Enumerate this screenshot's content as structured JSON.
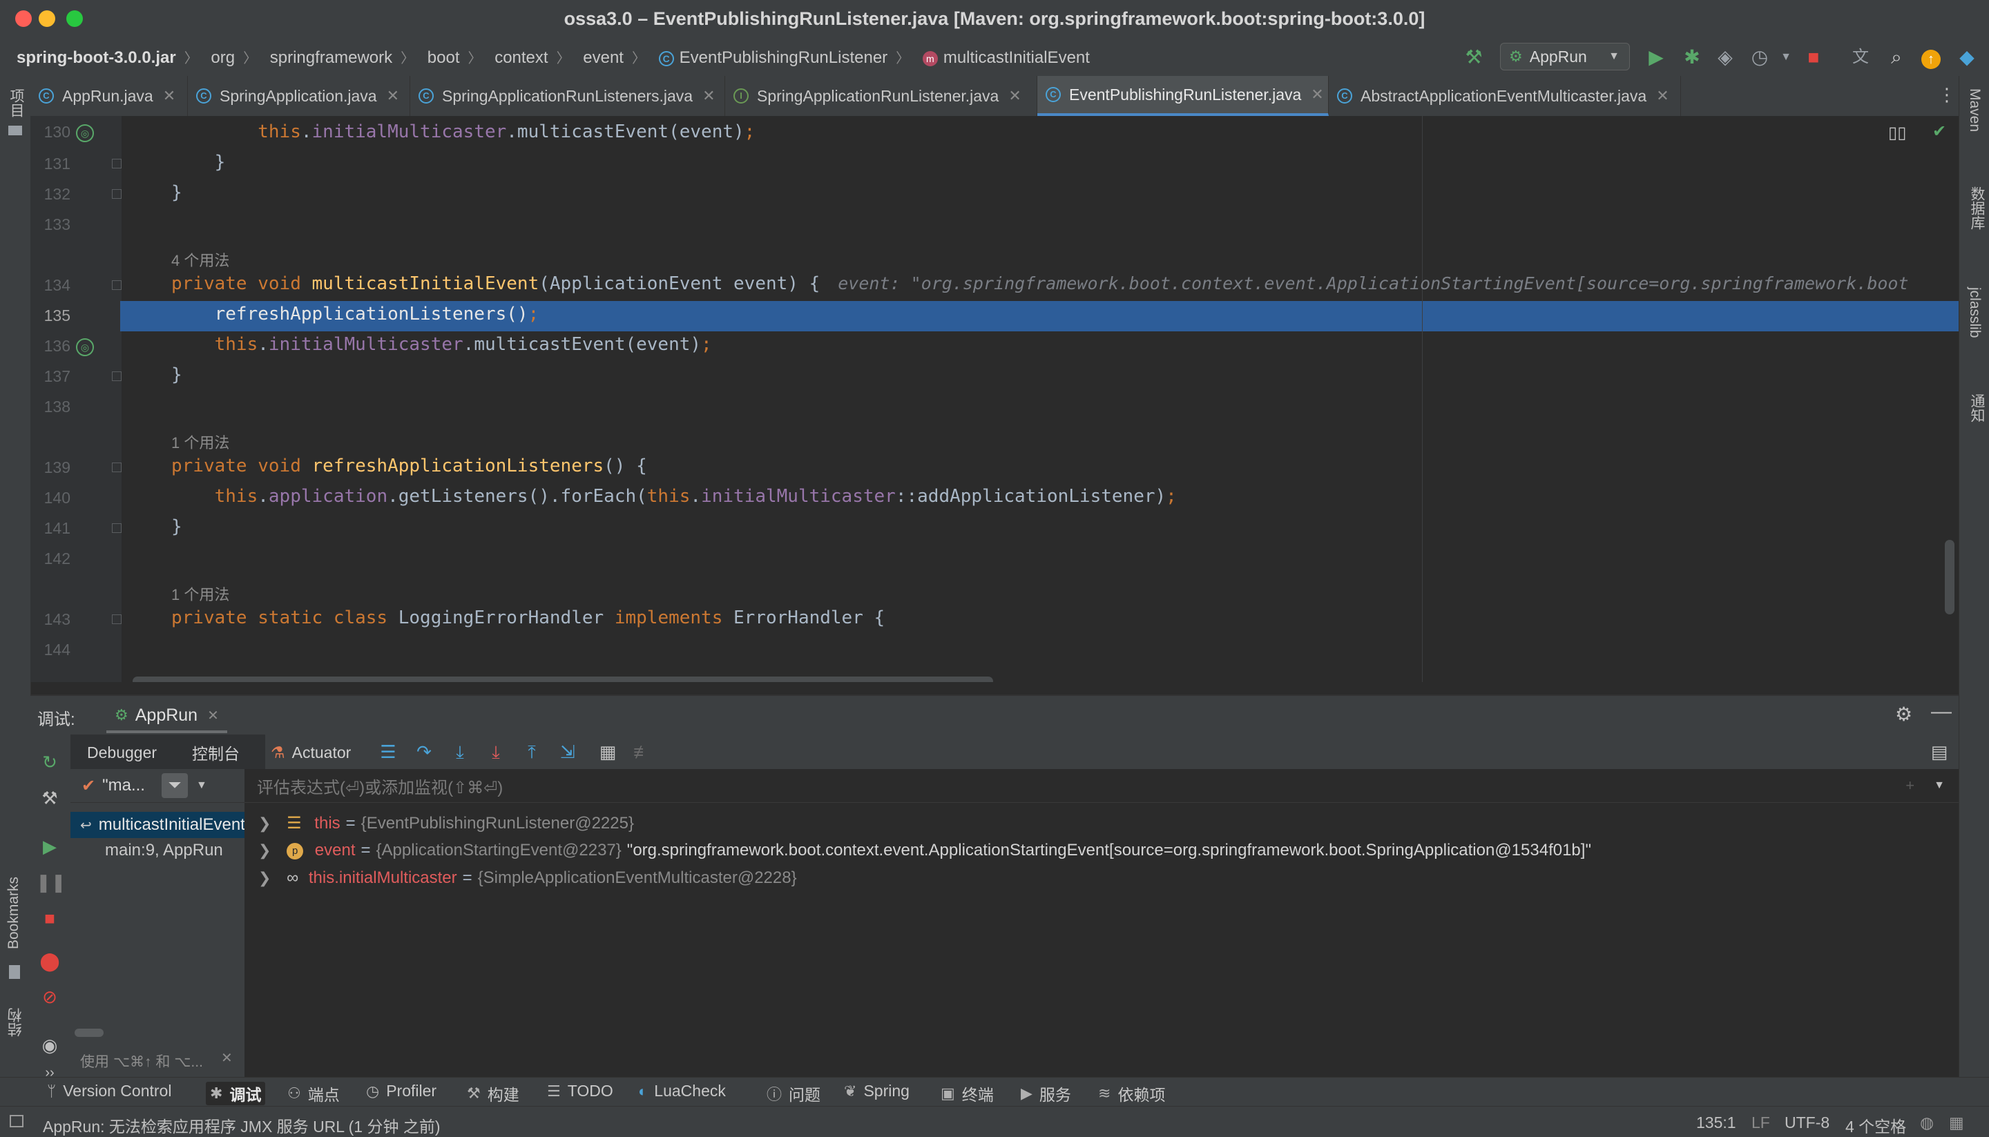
{
  "window": {
    "title": "ossa3.0 – EventPublishingRunListener.java [Maven: org.springframework.boot:spring-boot:3.0.0]"
  },
  "breadcrumb": [
    "spring-boot-3.0.0.jar",
    "org",
    "springframework",
    "boot",
    "context",
    "event",
    "EventPublishingRunListener",
    "multicastInitialEvent"
  ],
  "run_config": {
    "label": "AppRun"
  },
  "tabs": [
    {
      "label": "AppRun.java",
      "active": false
    },
    {
      "label": "SpringApplication.java",
      "active": false
    },
    {
      "label": "SpringApplicationRunListeners.java",
      "active": false
    },
    {
      "label": "SpringApplicationRunListener.java",
      "active": false
    },
    {
      "label": "EventPublishingRunListener.java",
      "active": true
    },
    {
      "label": "AbstractApplicationEventMulticaster.java",
      "active": false
    }
  ],
  "left_strip": {
    "project": "项目",
    "bookmarks": "Bookmarks",
    "structure": "结构"
  },
  "right_strip": {
    "maven": "Maven",
    "database": "数据库",
    "jclasslib": "jclasslib",
    "notifications": "通知"
  },
  "editor": {
    "lines": [
      {
        "num": "130",
        "code": "        this.initialMulticaster.multicastEvent(event);"
      },
      {
        "num": "131",
        "code": "    }"
      },
      {
        "num": "132",
        "code": "}"
      },
      {
        "num": "133",
        "code": ""
      },
      {
        "num": "134",
        "code": "private void multicastInitialEvent(ApplicationEvent event) {",
        "hint": "4 个用法"
      },
      {
        "num": "135",
        "code": "    refreshApplicationListeners();",
        "current": true
      },
      {
        "num": "136",
        "code": "    this.initialMulticaster.multicastEvent(event);"
      },
      {
        "num": "137",
        "code": "}"
      },
      {
        "num": "138",
        "code": ""
      },
      {
        "num": "139",
        "code": "private void refreshApplicationListeners() {",
        "hint": "1 个用法"
      },
      {
        "num": "140",
        "code": "    this.application.getListeners().forEach(this.initialMulticaster::addApplicationListener);"
      },
      {
        "num": "141",
        "code": "}"
      },
      {
        "num": "142",
        "code": ""
      },
      {
        "num": "143",
        "code": "private static class LoggingErrorHandler implements ErrorHandler {",
        "hint": "1 个用法"
      },
      {
        "num": "144",
        "code": ""
      }
    ],
    "inline_value": "event: \"org.springframework.boot.context.event.ApplicationStartingEvent[source=org.springframework.boot"
  },
  "debug": {
    "title": "调试:",
    "session": "AppRun",
    "tabs": {
      "debugger": "Debugger",
      "console": "控制台",
      "actuator": "Actuator"
    },
    "thread": "\"ma...",
    "eval_placeholder": "评估表达式(⏎)或添加监视(⇧⌘⏎)",
    "frames": [
      "multicastInitialEvent",
      "main:9, AppRun"
    ],
    "frames_hint": "使用 ⌥⌘↑ 和 ⌥...",
    "variables": [
      {
        "name": "this",
        "ref": "{EventPublishingRunListener@2225}",
        "value": ""
      },
      {
        "name": "event",
        "ref": "{ApplicationStartingEvent@2237}",
        "value": "\"org.springframework.boot.context.event.ApplicationStartingEvent[source=org.springframework.boot.SpringApplication@1534f01b]\""
      },
      {
        "name": "this.initialMulticaster",
        "ref": "{SimpleApplicationEventMulticaster@2228}",
        "value": ""
      }
    ]
  },
  "toolwindows": [
    "Version Control",
    "调试",
    "端点",
    "Profiler",
    "构建",
    "TODO",
    "LuaCheck",
    "问题",
    "Spring",
    "终端",
    "服务",
    "依赖项"
  ],
  "status": {
    "message": "AppRun: 无法检索应用程序 JMX 服务 URL (1 分钟 之前)",
    "position": "135:1",
    "line_sep": "LF",
    "encoding": "UTF-8",
    "indent": "4 个空格"
  },
  "colors": {
    "accent": "#4a88c7",
    "selection": "#2d5d99",
    "run": "#59a869",
    "stop": "#e0443e"
  }
}
